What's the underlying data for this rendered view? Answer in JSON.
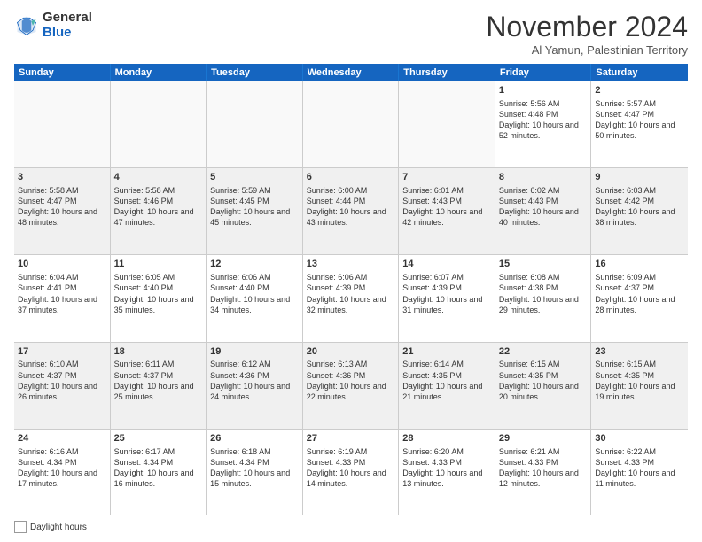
{
  "logo": {
    "general": "General",
    "blue": "Blue"
  },
  "title": "November 2024",
  "location": "Al Yamun, Palestinian Territory",
  "days_of_week": [
    "Sunday",
    "Monday",
    "Tuesday",
    "Wednesday",
    "Thursday",
    "Friday",
    "Saturday"
  ],
  "weeks": [
    [
      {
        "day": "",
        "sunrise": "",
        "sunset": "",
        "daylight": "",
        "empty": true
      },
      {
        "day": "",
        "sunrise": "",
        "sunset": "",
        "daylight": "",
        "empty": true
      },
      {
        "day": "",
        "sunrise": "",
        "sunset": "",
        "daylight": "",
        "empty": true
      },
      {
        "day": "",
        "sunrise": "",
        "sunset": "",
        "daylight": "",
        "empty": true
      },
      {
        "day": "",
        "sunrise": "",
        "sunset": "",
        "daylight": "",
        "empty": true
      },
      {
        "day": "1",
        "sunrise": "Sunrise: 5:56 AM",
        "sunset": "Sunset: 4:48 PM",
        "daylight": "Daylight: 10 hours and 52 minutes."
      },
      {
        "day": "2",
        "sunrise": "Sunrise: 5:57 AM",
        "sunset": "Sunset: 4:47 PM",
        "daylight": "Daylight: 10 hours and 50 minutes."
      }
    ],
    [
      {
        "day": "3",
        "sunrise": "Sunrise: 5:58 AM",
        "sunset": "Sunset: 4:47 PM",
        "daylight": "Daylight: 10 hours and 48 minutes."
      },
      {
        "day": "4",
        "sunrise": "Sunrise: 5:58 AM",
        "sunset": "Sunset: 4:46 PM",
        "daylight": "Daylight: 10 hours and 47 minutes."
      },
      {
        "day": "5",
        "sunrise": "Sunrise: 5:59 AM",
        "sunset": "Sunset: 4:45 PM",
        "daylight": "Daylight: 10 hours and 45 minutes."
      },
      {
        "day": "6",
        "sunrise": "Sunrise: 6:00 AM",
        "sunset": "Sunset: 4:44 PM",
        "daylight": "Daylight: 10 hours and 43 minutes."
      },
      {
        "day": "7",
        "sunrise": "Sunrise: 6:01 AM",
        "sunset": "Sunset: 4:43 PM",
        "daylight": "Daylight: 10 hours and 42 minutes."
      },
      {
        "day": "8",
        "sunrise": "Sunrise: 6:02 AM",
        "sunset": "Sunset: 4:43 PM",
        "daylight": "Daylight: 10 hours and 40 minutes."
      },
      {
        "day": "9",
        "sunrise": "Sunrise: 6:03 AM",
        "sunset": "Sunset: 4:42 PM",
        "daylight": "Daylight: 10 hours and 38 minutes."
      }
    ],
    [
      {
        "day": "10",
        "sunrise": "Sunrise: 6:04 AM",
        "sunset": "Sunset: 4:41 PM",
        "daylight": "Daylight: 10 hours and 37 minutes."
      },
      {
        "day": "11",
        "sunrise": "Sunrise: 6:05 AM",
        "sunset": "Sunset: 4:40 PM",
        "daylight": "Daylight: 10 hours and 35 minutes."
      },
      {
        "day": "12",
        "sunrise": "Sunrise: 6:06 AM",
        "sunset": "Sunset: 4:40 PM",
        "daylight": "Daylight: 10 hours and 34 minutes."
      },
      {
        "day": "13",
        "sunrise": "Sunrise: 6:06 AM",
        "sunset": "Sunset: 4:39 PM",
        "daylight": "Daylight: 10 hours and 32 minutes."
      },
      {
        "day": "14",
        "sunrise": "Sunrise: 6:07 AM",
        "sunset": "Sunset: 4:39 PM",
        "daylight": "Daylight: 10 hours and 31 minutes."
      },
      {
        "day": "15",
        "sunrise": "Sunrise: 6:08 AM",
        "sunset": "Sunset: 4:38 PM",
        "daylight": "Daylight: 10 hours and 29 minutes."
      },
      {
        "day": "16",
        "sunrise": "Sunrise: 6:09 AM",
        "sunset": "Sunset: 4:37 PM",
        "daylight": "Daylight: 10 hours and 28 minutes."
      }
    ],
    [
      {
        "day": "17",
        "sunrise": "Sunrise: 6:10 AM",
        "sunset": "Sunset: 4:37 PM",
        "daylight": "Daylight: 10 hours and 26 minutes."
      },
      {
        "day": "18",
        "sunrise": "Sunrise: 6:11 AM",
        "sunset": "Sunset: 4:37 PM",
        "daylight": "Daylight: 10 hours and 25 minutes."
      },
      {
        "day": "19",
        "sunrise": "Sunrise: 6:12 AM",
        "sunset": "Sunset: 4:36 PM",
        "daylight": "Daylight: 10 hours and 24 minutes."
      },
      {
        "day": "20",
        "sunrise": "Sunrise: 6:13 AM",
        "sunset": "Sunset: 4:36 PM",
        "daylight": "Daylight: 10 hours and 22 minutes."
      },
      {
        "day": "21",
        "sunrise": "Sunrise: 6:14 AM",
        "sunset": "Sunset: 4:35 PM",
        "daylight": "Daylight: 10 hours and 21 minutes."
      },
      {
        "day": "22",
        "sunrise": "Sunrise: 6:15 AM",
        "sunset": "Sunset: 4:35 PM",
        "daylight": "Daylight: 10 hours and 20 minutes."
      },
      {
        "day": "23",
        "sunrise": "Sunrise: 6:15 AM",
        "sunset": "Sunset: 4:35 PM",
        "daylight": "Daylight: 10 hours and 19 minutes."
      }
    ],
    [
      {
        "day": "24",
        "sunrise": "Sunrise: 6:16 AM",
        "sunset": "Sunset: 4:34 PM",
        "daylight": "Daylight: 10 hours and 17 minutes."
      },
      {
        "day": "25",
        "sunrise": "Sunrise: 6:17 AM",
        "sunset": "Sunset: 4:34 PM",
        "daylight": "Daylight: 10 hours and 16 minutes."
      },
      {
        "day": "26",
        "sunrise": "Sunrise: 6:18 AM",
        "sunset": "Sunset: 4:34 PM",
        "daylight": "Daylight: 10 hours and 15 minutes."
      },
      {
        "day": "27",
        "sunrise": "Sunrise: 6:19 AM",
        "sunset": "Sunset: 4:33 PM",
        "daylight": "Daylight: 10 hours and 14 minutes."
      },
      {
        "day": "28",
        "sunrise": "Sunrise: 6:20 AM",
        "sunset": "Sunset: 4:33 PM",
        "daylight": "Daylight: 10 hours and 13 minutes."
      },
      {
        "day": "29",
        "sunrise": "Sunrise: 6:21 AM",
        "sunset": "Sunset: 4:33 PM",
        "daylight": "Daylight: 10 hours and 12 minutes."
      },
      {
        "day": "30",
        "sunrise": "Sunrise: 6:22 AM",
        "sunset": "Sunset: 4:33 PM",
        "daylight": "Daylight: 10 hours and 11 minutes."
      }
    ]
  ],
  "footer": {
    "daylight_label": "Daylight hours"
  }
}
